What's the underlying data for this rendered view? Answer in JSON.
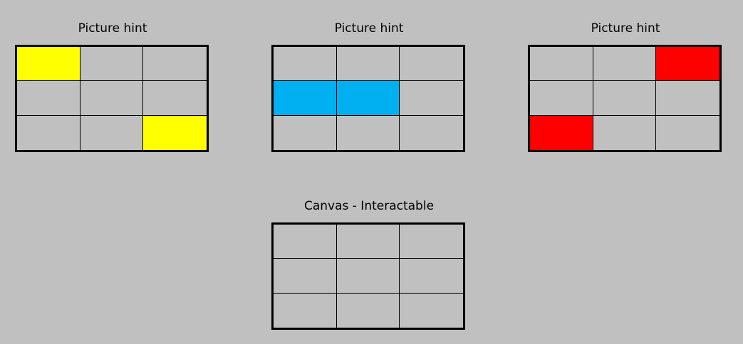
{
  "colors": {
    "background": "#c0c0c0",
    "grid_line": "#000000",
    "yellow": "#ffff00",
    "blue": "#00b0f0",
    "red": "#ff0000"
  },
  "hints": [
    {
      "title": "Picture hint",
      "fill_color": "#ffff00",
      "cells": [
        [
          1,
          0,
          0
        ],
        [
          0,
          0,
          0
        ],
        [
          0,
          0,
          1
        ]
      ]
    },
    {
      "title": "Picture hint",
      "fill_color": "#00b0f0",
      "cells": [
        [
          0,
          0,
          0
        ],
        [
          1,
          1,
          0
        ],
        [
          0,
          0,
          0
        ]
      ]
    },
    {
      "title": "Picture hint",
      "fill_color": "#ff0000",
      "cells": [
        [
          0,
          0,
          1
        ],
        [
          0,
          0,
          0
        ],
        [
          1,
          0,
          0
        ]
      ]
    }
  ],
  "canvas": {
    "title": "Canvas - Interactable",
    "cells": [
      [
        0,
        0,
        0
      ],
      [
        0,
        0,
        0
      ],
      [
        0,
        0,
        0
      ]
    ]
  }
}
